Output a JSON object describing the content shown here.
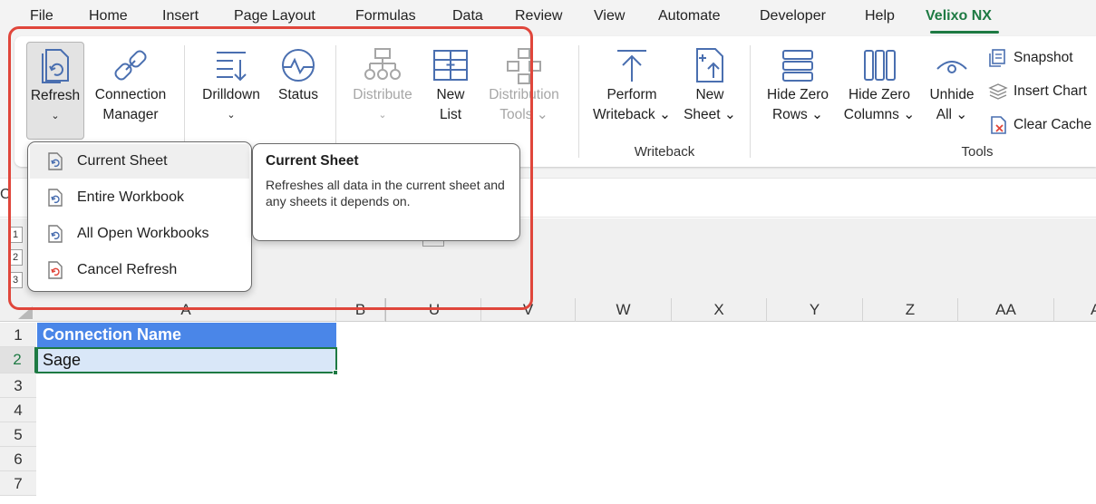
{
  "menubar": {
    "tabs": [
      "File",
      "Home",
      "Insert",
      "Page Layout",
      "Formulas",
      "Data",
      "Review",
      "View",
      "Automate",
      "Developer",
      "Help",
      "Velixo NX"
    ],
    "active_tab": "Velixo NX",
    "accent_color": "#1e7a43"
  },
  "ribbon": {
    "refresh": {
      "label": "Refresh",
      "chevron": "⌄"
    },
    "connection_manager": {
      "line1": "Connection",
      "line2": "Manager"
    },
    "drilldown": {
      "label": "Drilldown",
      "chevron": "⌄"
    },
    "status": {
      "label": "Status"
    },
    "distribute": {
      "label": "Distribute",
      "chevron": "⌄"
    },
    "new_list": {
      "line1": "New",
      "line2": "List"
    },
    "distribution_tools": {
      "line1": "Distribution",
      "line2": "Tools ⌄"
    },
    "perform_writeback": {
      "line1": "Perform",
      "line2": "Writeback ⌄"
    },
    "new_sheet": {
      "line1": "New",
      "line2": "Sheet ⌄"
    },
    "writeback_group": "Writeback",
    "hide_zero_rows": {
      "line1": "Hide Zero",
      "line2": "Rows ⌄"
    },
    "hide_zero_columns": {
      "line1": "Hide Zero",
      "line2": "Columns ⌄"
    },
    "unhide_all": {
      "line1": "Unhide",
      "line2": "All ⌄"
    },
    "snapshot": "Snapshot",
    "insert_chart": "Insert Chart",
    "clear_cache": "Clear Cache",
    "tools_group": "Tools"
  },
  "formula_bar": {
    "namebox_fragment": "C"
  },
  "outline": {
    "levels": [
      "1",
      "2",
      "3"
    ]
  },
  "grid": {
    "columns": [
      "A",
      "B",
      "U",
      "V",
      "W",
      "X",
      "Y",
      "Z",
      "AA",
      "A"
    ],
    "rows": [
      "1",
      "2",
      "3",
      "4",
      "5",
      "6",
      "7"
    ],
    "cell_a1": "Connection Name",
    "cell_a2": "Sage",
    "header_fill": "#4a86e8"
  },
  "dropdown": {
    "items": [
      "Current Sheet",
      "Entire Workbook",
      "All Open Workbooks",
      "Cancel Refresh"
    ]
  },
  "tooltip": {
    "title": "Current Sheet",
    "body": "Refreshes all data in the current sheet and any sheets it depends on."
  },
  "annotation": {
    "highlight_color": "#e0463b"
  }
}
